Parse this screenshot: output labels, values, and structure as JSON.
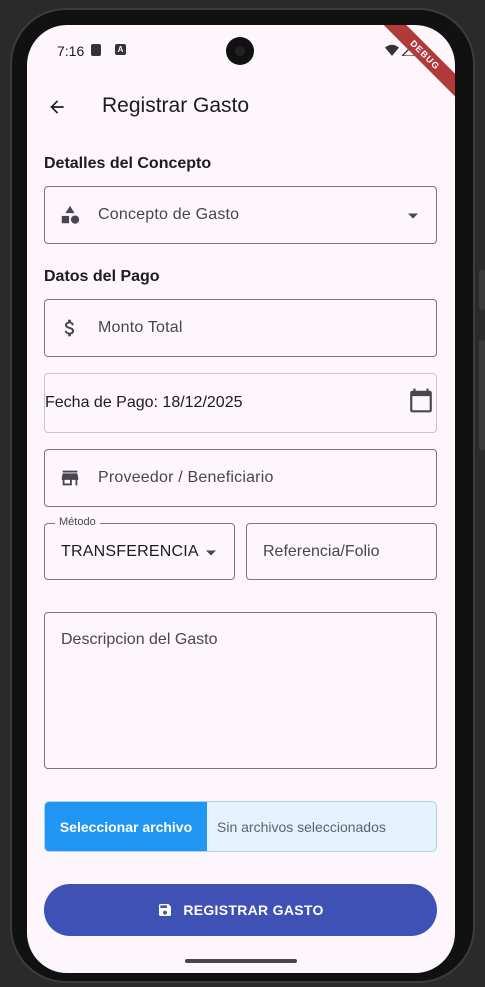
{
  "status_bar": {
    "time": "7:16",
    "debug_label": "DEBUG"
  },
  "app_bar": {
    "title": "Registrar Gasto",
    "back_icon": "arrow-left-icon"
  },
  "sections": {
    "concepto_title": "Detalles del Concepto",
    "pago_title": "Datos del Pago"
  },
  "fields": {
    "concepto": {
      "label": "Concepto de Gasto",
      "icon": "category-shapes-icon"
    },
    "monto": {
      "label": "Monto Total",
      "icon": "dollar-icon"
    },
    "fecha": {
      "text": "Fecha de Pago: 18/12/2025",
      "icon": "calendar-icon"
    },
    "proveedor": {
      "label": "Proveedor / Beneficiario",
      "icon": "store-icon"
    },
    "metodo": {
      "label": "Método",
      "value": "TRANSFERENCIA"
    },
    "referencia": {
      "label": "Referencia/Folio"
    },
    "descripcion": {
      "label": "Descripcion del Gasto"
    }
  },
  "file_picker": {
    "button_label": "Seleccionar archivo",
    "status": "Sin archivos seleccionados"
  },
  "submit": {
    "label": "REGISTRAR GASTO",
    "icon": "save-icon"
  },
  "colors": {
    "background": "#fdf6fd",
    "primary_button": "#3f51b5",
    "file_button": "#2196f3",
    "file_bg": "#e3f2fd",
    "debug_ribbon": "#b03a3a"
  }
}
